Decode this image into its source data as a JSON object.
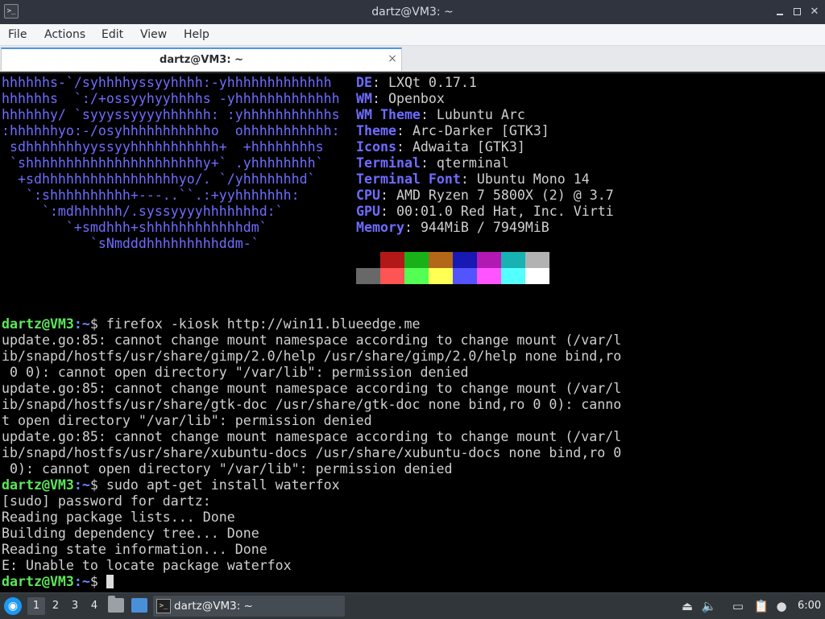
{
  "window": {
    "title": "dartz@VM3: ~",
    "app_icon_glyph": ">_"
  },
  "menubar": {
    "items": [
      "File",
      "Actions",
      "Edit",
      "View",
      "Help"
    ]
  },
  "tabs": [
    {
      "label": "dartz@VM3: ~",
      "close_glyph": "×"
    }
  ],
  "neofetch": {
    "logo_lines": [
      "hhhhhhs-`/syhhhhyssyyhhhh:-yhhhhhhhhhhhhh",
      "hhhhhhs  `:/+ossyyhyyhhhhs -yhhhhhhhhhhhhh",
      "hhhhhhy/ `syyyssyyyyhhhhhh: :yhhhhhhhhhhhs",
      ":hhhhhhyo:-/osyhhhhhhhhhhho  ohhhhhhhhhhh:",
      " sdhhhhhhhyyssyyhhhhhhhhhhh+  +hhhhhhhhs",
      " `shhhhhhhhhhhhhhhhhhhhhhy+` .yhhhhhhhh`",
      "  +sdhhhhhhhhhhhhhhhhhyo/. `/yhhhhhhhd`",
      "   `:shhhhhhhhhh+---..``.:+yyhhhhhhh:",
      "     `:mdhhhhhh/.syssyyyyhhhhhhhd:`",
      "        `+smdhhh+shhhhhhhhhhhhdm`",
      "           `sNmdddhhhhhhhhhddm-`"
    ],
    "info": [
      {
        "key": "DE",
        "value": " LXQt 0.17.1"
      },
      {
        "key": "WM",
        "value": " Openbox"
      },
      {
        "key": "WM Theme",
        "value": " Lubuntu Arc"
      },
      {
        "key": "Theme",
        "value": " Arc-Darker [GTK3]"
      },
      {
        "key": "Icons",
        "value": " Adwaita [GTK3]"
      },
      {
        "key": "Terminal",
        "value": " qterminal"
      },
      {
        "key": "Terminal Font",
        "value": " Ubuntu Mono 14"
      },
      {
        "key": "CPU",
        "value": " AMD Ryzen 7 5800X (2) @ 3.7"
      },
      {
        "key": "GPU",
        "value": " 00:01.0 Red Hat, Inc. Virti"
      },
      {
        "key": "Memory",
        "value": " 944MiB / 7949MiB"
      }
    ],
    "palette_row1": [
      "#000000",
      "#b21818",
      "#18b218",
      "#b26818",
      "#1818b2",
      "#b218b2",
      "#18b2b2",
      "#b2b2b2"
    ],
    "palette_row2": [
      "#686868",
      "#ff5454",
      "#54ff54",
      "#ffff54",
      "#5454ff",
      "#ff54ff",
      "#54ffff",
      "#ffffff"
    ]
  },
  "terminal": {
    "lines": [
      {
        "type": "prompt",
        "user": "dartz@VM3",
        "path": ":~",
        "symbol": "$ ",
        "command": "firefox -kiosk http://win11.blueedge.me"
      },
      {
        "type": "output",
        "text": "update.go:85: cannot change mount namespace according to change mount (/var/l"
      },
      {
        "type": "output",
        "text": "ib/snapd/hostfs/usr/share/gimp/2.0/help /usr/share/gimp/2.0/help none bind,ro"
      },
      {
        "type": "output",
        "text": " 0 0): cannot open directory \"/var/lib\": permission denied"
      },
      {
        "type": "output",
        "text": "update.go:85: cannot change mount namespace according to change mount (/var/l"
      },
      {
        "type": "output",
        "text": "ib/snapd/hostfs/usr/share/gtk-doc /usr/share/gtk-doc none bind,ro 0 0): canno"
      },
      {
        "type": "output",
        "text": "t open directory \"/var/lib\": permission denied"
      },
      {
        "type": "output",
        "text": "update.go:85: cannot change mount namespace according to change mount (/var/l"
      },
      {
        "type": "output",
        "text": "ib/snapd/hostfs/usr/share/xubuntu-docs /usr/share/xubuntu-docs none bind,ro 0"
      },
      {
        "type": "output",
        "text": " 0): cannot open directory \"/var/lib\": permission denied"
      },
      {
        "type": "prompt",
        "user": "dartz@VM3",
        "path": ":~",
        "symbol": "$ ",
        "command": "sudo apt-get install waterfox"
      },
      {
        "type": "output",
        "text": "[sudo] password for dartz:"
      },
      {
        "type": "output",
        "text": "Reading package lists... Done"
      },
      {
        "type": "output",
        "text": "Building dependency tree... Done"
      },
      {
        "type": "output",
        "text": "Reading state information... Done"
      },
      {
        "type": "output",
        "text": "E: Unable to locate package waterfox"
      },
      {
        "type": "prompt",
        "user": "dartz@VM3",
        "path": ":~",
        "symbol": "$ ",
        "command": "",
        "cursor": true
      }
    ]
  },
  "taskbar": {
    "desktops": [
      "1",
      "2",
      "3",
      "4"
    ],
    "active_desktop": "1",
    "task_label": "dartz@VM3: ~",
    "clock": "6:00",
    "accent": "#1d99f3"
  }
}
